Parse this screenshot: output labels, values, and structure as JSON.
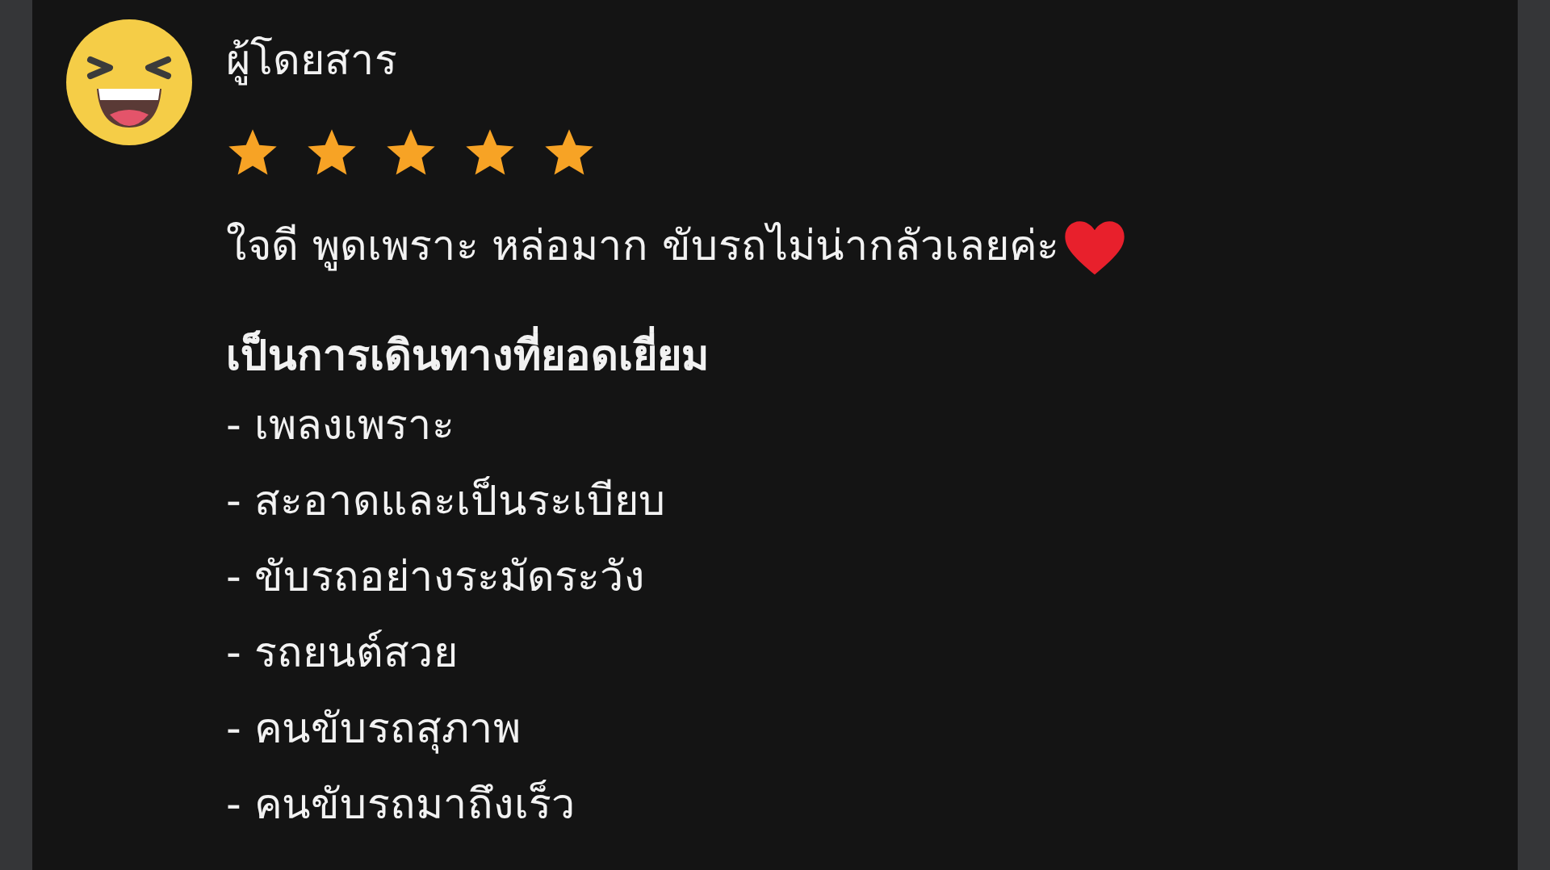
{
  "review": {
    "author": "ผู้โดยสาร",
    "stars": 5,
    "comment": "ใจดี พูดเพราะ หล่อมาก ขับรถไม่น่ากลัวเลยค่ะ",
    "highlights_title": "เป็นการเดินทางที่ยอดเยี่ยม",
    "highlights": [
      "- เพลงเพราะ",
      "- สะอาดและเป็นระเบียบ",
      "- ขับรถอย่างระมัดระวัง",
      "- รถยนต์สวย",
      "- คนขับรถสุภาพ",
      "- คนขับรถมาถึงเร็ว"
    ]
  }
}
